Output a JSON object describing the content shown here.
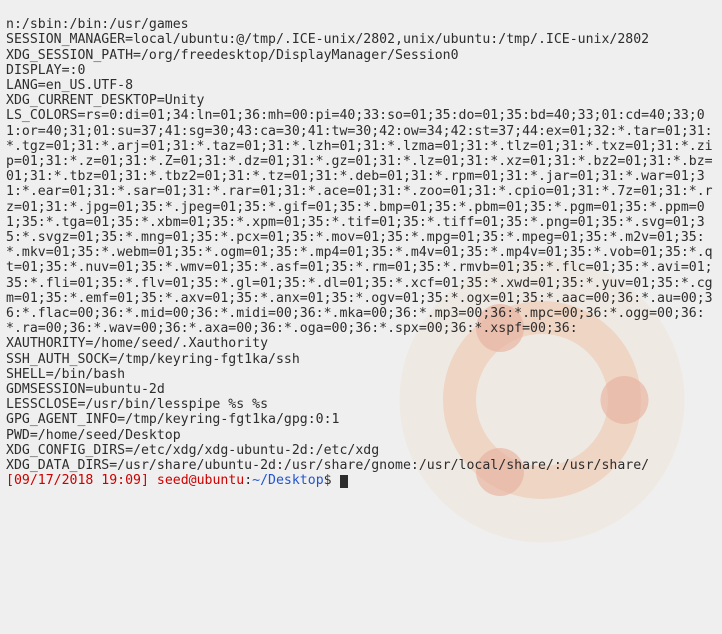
{
  "env": {
    "path_tail": "n:/sbin:/bin:/usr/games",
    "session_manager": "SESSION_MANAGER=local/ubuntu:@/tmp/.ICE-unix/2802,unix/ubuntu:/tmp/.ICE-unix/2802",
    "xdg_session_path": "XDG_SESSION_PATH=/org/freedesktop/DisplayManager/Session0",
    "display": "DISPLAY=:0",
    "lang": "LANG=en_US.UTF-8",
    "xdg_current_desktop": "XDG_CURRENT_DESKTOP=Unity",
    "ls_colors": "LS_COLORS=rs=0:di=01;34:ln=01;36:mh=00:pi=40;33:so=01;35:do=01;35:bd=40;33;01:cd=40;33;01:or=40;31;01:su=37;41:sg=30;43:ca=30;41:tw=30;42:ow=34;42:st=37;44:ex=01;32:*.tar=01;31:*.tgz=01;31:*.arj=01;31:*.taz=01;31:*.lzh=01;31:*.lzma=01;31:*.tlz=01;31:*.txz=01;31:*.zip=01;31:*.z=01;31:*.Z=01;31:*.dz=01;31:*.gz=01;31:*.lz=01;31:*.xz=01;31:*.bz2=01;31:*.bz=01;31:*.tbz=01;31:*.tbz2=01;31:*.tz=01;31:*.deb=01;31:*.rpm=01;31:*.jar=01;31:*.war=01;31:*.ear=01;31:*.sar=01;31:*.rar=01;31:*.ace=01;31:*.zoo=01;31:*.cpio=01;31:*.7z=01;31:*.rz=01;31:*.jpg=01;35:*.jpeg=01;35:*.gif=01;35:*.bmp=01;35:*.pbm=01;35:*.pgm=01;35:*.ppm=01;35:*.tga=01;35:*.xbm=01;35:*.xpm=01;35:*.tif=01;35:*.tiff=01;35:*.png=01;35:*.svg=01;35:*.svgz=01;35:*.mng=01;35:*.pcx=01;35:*.mov=01;35:*.mpg=01;35:*.mpeg=01;35:*.m2v=01;35:*.mkv=01;35:*.webm=01;35:*.ogm=01;35:*.mp4=01;35:*.m4v=01;35:*.mp4v=01;35:*.vob=01;35:*.qt=01;35:*.nuv=01;35:*.wmv=01;35:*.asf=01;35:*.rm=01;35:*.rmvb=01;35:*.flc=01;35:*.avi=01;35:*.fli=01;35:*.flv=01;35:*.gl=01;35:*.dl=01;35:*.xcf=01;35:*.xwd=01;35:*.yuv=01;35:*.cgm=01;35:*.emf=01;35:*.axv=01;35:*.anx=01;35:*.ogv=01;35:*.ogx=01;35:*.aac=00;36:*.au=00;36:*.flac=00;36:*.mid=00;36:*.midi=00;36:*.mka=00;36:*.mp3=00;36:*.mpc=00;36:*.ogg=00;36:*.ra=00;36:*.wav=00;36:*.axa=00;36:*.oga=00;36:*.spx=00;36:*.xspf=00;36:",
    "xauthority": "XAUTHORITY=/home/seed/.Xauthority",
    "ssh_auth_sock": "SSH_AUTH_SOCK=/tmp/keyring-fgt1ka/ssh",
    "shell": "SHELL=/bin/bash",
    "gdmsession": "GDMSESSION=ubuntu-2d",
    "lessclose": "LESSCLOSE=/usr/bin/lesspipe %s %s",
    "gpg_agent_info": "GPG_AGENT_INFO=/tmp/keyring-fgt1ka/gpg:0:1",
    "pwd": "PWD=/home/seed/Desktop",
    "xdg_config_dirs": "XDG_CONFIG_DIRS=/etc/xdg/xdg-ubuntu-2d:/etc/xdg",
    "xdg_data_dirs": "XDG_DATA_DIRS=/usr/share/ubuntu-2d:/usr/share/gnome:/usr/local/share/:/usr/share/"
  },
  "prompt": {
    "timestamp": "[09/17/2018 19:09]",
    "user_host": "seed@ubuntu",
    "sep": ":",
    "cwd": "~/Desktop",
    "suffix": "$ "
  }
}
